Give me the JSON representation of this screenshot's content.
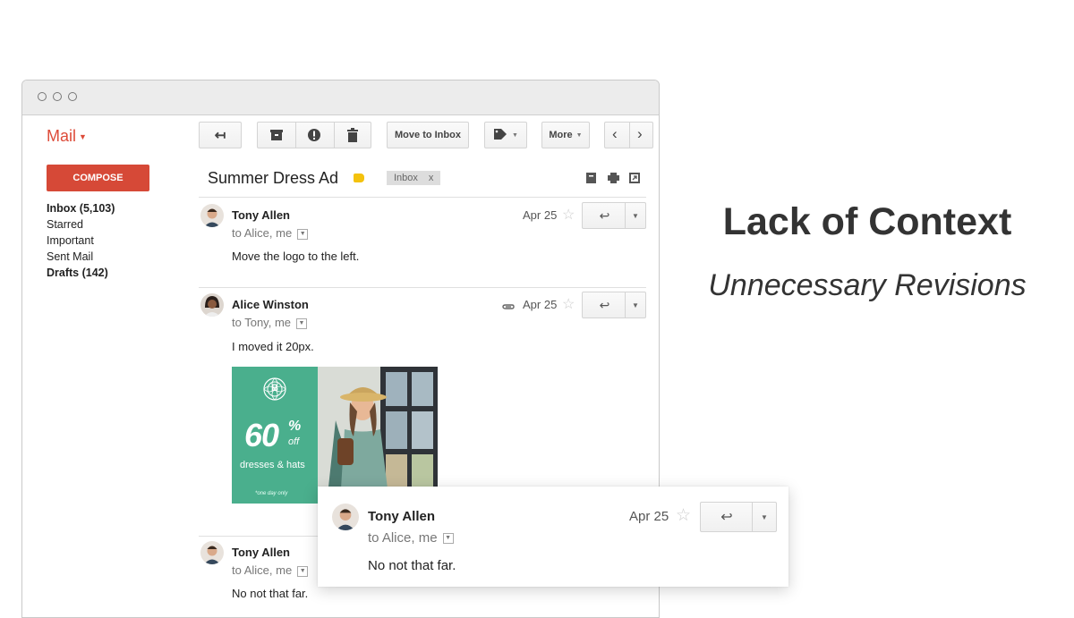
{
  "window": {
    "dots": [
      "o",
      "o",
      "o"
    ]
  },
  "app": {
    "name": "Mail",
    "compose_label": "COMPOSE"
  },
  "toolbar": {
    "back_icon": "back-arrow-icon",
    "move_to_inbox": "Move to Inbox",
    "more": "More",
    "icons": [
      "archive-icon",
      "report-spam-icon",
      "trash-icon",
      "label-icon",
      "prev-icon",
      "next-icon"
    ]
  },
  "nav": {
    "items": [
      {
        "label": "Inbox (5,103)",
        "bold": true
      },
      {
        "label": "Starred",
        "bold": false
      },
      {
        "label": "Important",
        "bold": false
      },
      {
        "label": "Sent Mail",
        "bold": false
      },
      {
        "label": "Drafts (142)",
        "bold": true
      }
    ]
  },
  "thread": {
    "subject": "Summer Dress Ad",
    "label_chip": "Inbox",
    "label_chip_close": "x",
    "label_color": "#f4c20d",
    "messages": [
      {
        "sender": "Tony Allen",
        "to": "to Alice, me",
        "date": "Apr 25",
        "body": "Move the logo to the left."
      },
      {
        "sender": "Alice Winston",
        "to": "to Tony, me",
        "date": "Apr 25",
        "body": "I moved it 20px.",
        "attachment": true
      },
      {
        "sender": "Tony Allen",
        "to": "to Alice, me",
        "body": "No not that far."
      }
    ]
  },
  "ad": {
    "big_number": "60",
    "percent": "%",
    "off": "off",
    "subtitle": "dresses & hats",
    "fine_print": "*one day only",
    "logo_letter": "B",
    "color": "#4aaf8d"
  },
  "popup": {
    "sender": "Tony Allen",
    "to": "to Alice, me",
    "date": "Apr 25",
    "body": "No not that far."
  },
  "slide": {
    "title": "Lack of Context",
    "subtitle": "Unnecessary Revisions"
  },
  "colors": {
    "brand_red": "#dd4b39",
    "compose_red": "#d64937"
  }
}
